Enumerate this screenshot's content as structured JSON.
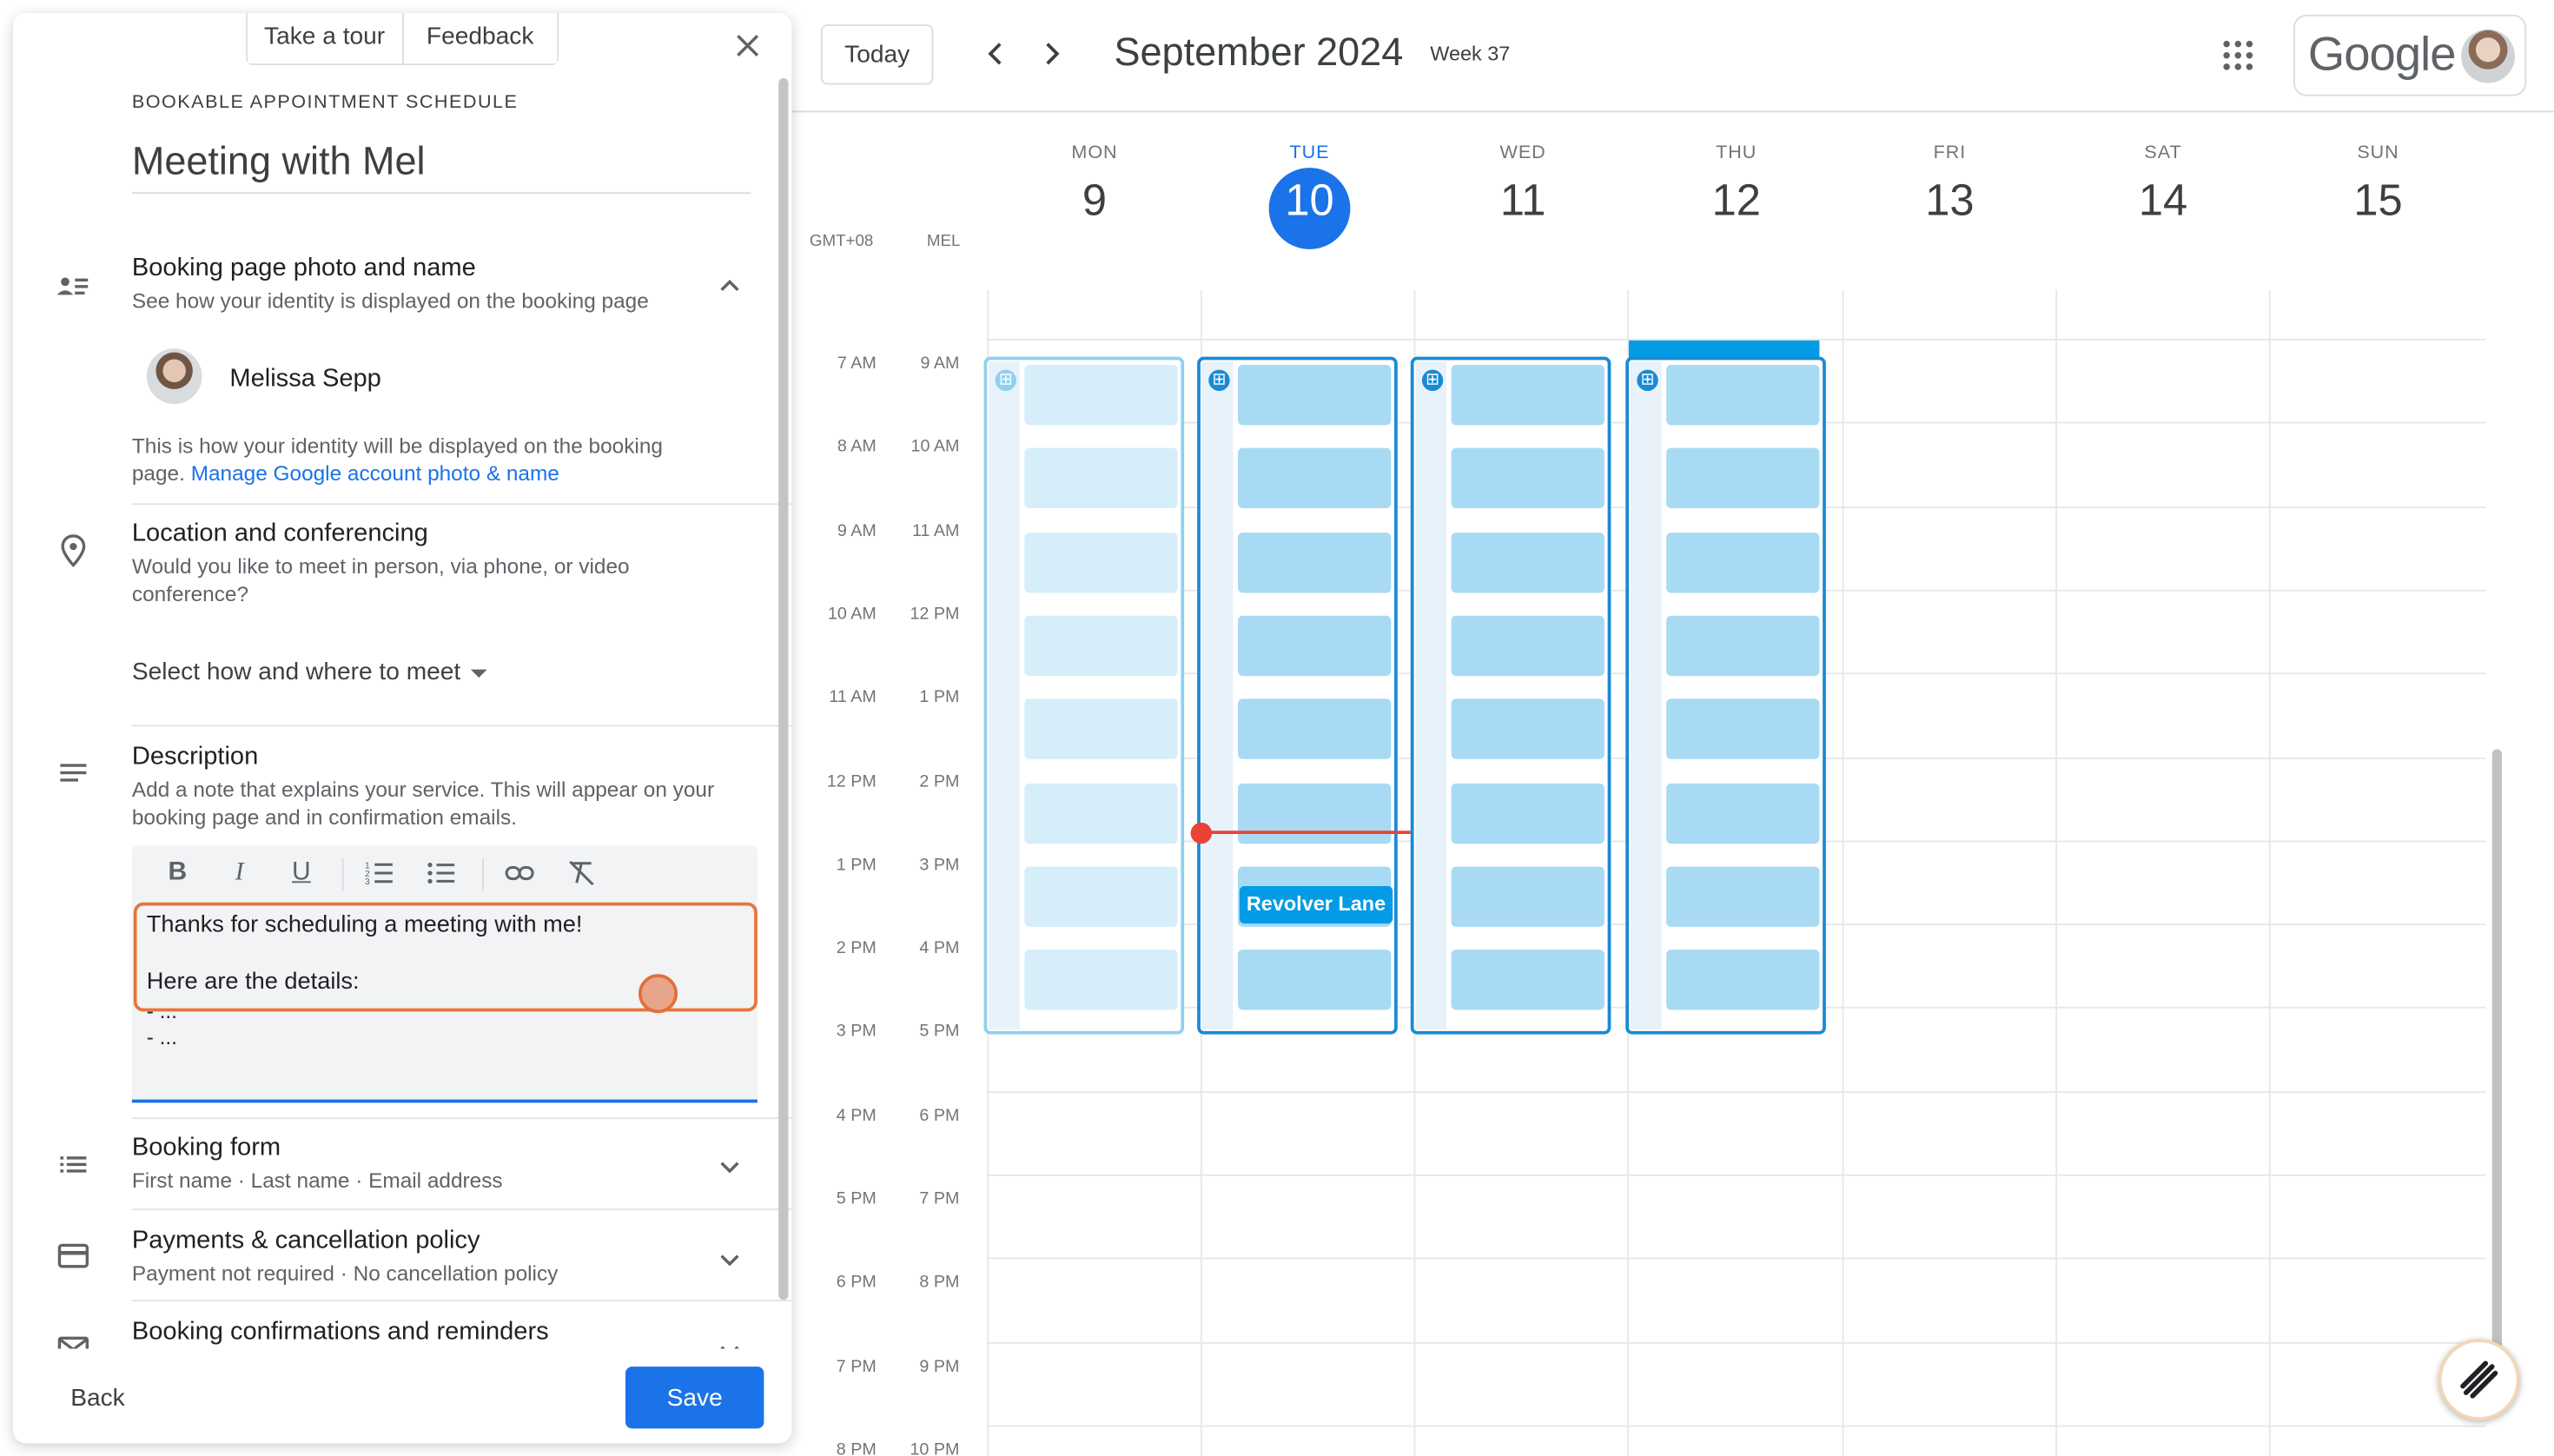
{
  "calendar": {
    "today_label": "Today",
    "month_title": "September 2024",
    "week_label": "Week 37",
    "logo_text": "Google",
    "timezones": [
      "GMT+08",
      "MEL"
    ],
    "days": [
      {
        "dow": "MON",
        "num": "9"
      },
      {
        "dow": "TUE",
        "num": "10"
      },
      {
        "dow": "WED",
        "num": "11"
      },
      {
        "dow": "THU",
        "num": "12"
      },
      {
        "dow": "FRI",
        "num": "13"
      },
      {
        "dow": "SAT",
        "num": "14"
      },
      {
        "dow": "SUN",
        "num": "15"
      }
    ],
    "times_local": [
      "7 AM",
      "8 AM",
      "9 AM",
      "10 AM",
      "11 AM",
      "12 PM",
      "1 PM",
      "2 PM",
      "3 PM",
      "4 PM",
      "5 PM",
      "6 PM",
      "7 PM",
      "8 PM"
    ],
    "times_mel": [
      "9 AM",
      "10 AM",
      "11 AM",
      "12 PM",
      "1 PM",
      "2 PM",
      "3 PM",
      "4 PM",
      "5 PM",
      "6 PM",
      "7 PM",
      "8 PM",
      "9 PM",
      "10 PM"
    ],
    "event_chip": "Revolver Lane",
    "colors": {
      "accent": "#1a73e8",
      "slot": "#a8daf3",
      "now_line": "#ea4335",
      "event": "#039be5"
    }
  },
  "panel": {
    "take_tour": "Take a tour",
    "feedback": "Feedback",
    "overline": "BOOKABLE APPOINTMENT SCHEDULE",
    "title": "Meeting with Mel",
    "booking_page": {
      "title": "Booking page photo and name",
      "subtitle": "See how your identity is displayed on the booking page",
      "person": "Melissa Sepp",
      "note_prefix": "This is how your identity will be displayed on the booking page.",
      "note_link": "Manage Google account photo & name"
    },
    "location": {
      "title": "Location and conferencing",
      "subtitle": "Would you like to meet in person, via phone, or video conference?",
      "select": "Select how and where to meet"
    },
    "description": {
      "title": "Description",
      "subtitle": "Add a note that explains your service. This will appear on your booking page and in confirmation emails.",
      "lines": [
        "Thanks for scheduling a meeting with me!",
        "Here are the details:",
        "- ...",
        "- ..."
      ]
    },
    "booking_form": {
      "title": "Booking form",
      "subtitle": "First name · Last name · Email address"
    },
    "payments": {
      "title": "Payments & cancellation policy",
      "subtitle": "Payment not required · No cancellation policy"
    },
    "confirmations": {
      "title": "Booking confirmations and reminders"
    },
    "back": "Back",
    "save": "Save"
  }
}
